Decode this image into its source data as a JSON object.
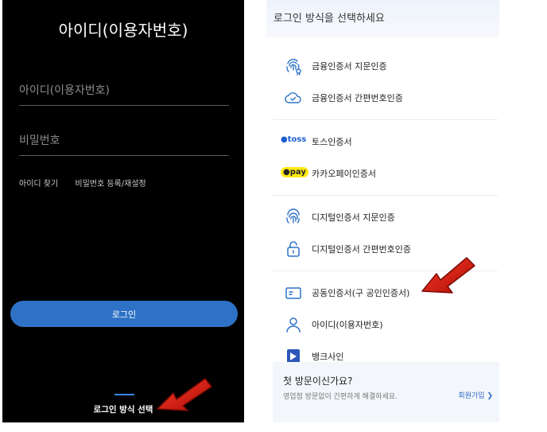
{
  "left": {
    "title": "아이디(이용자번호)",
    "id_placeholder": "아이디(이용자번호)",
    "pw_placeholder": "비밀번호",
    "find_id": "아이디 찾기",
    "pw_register": "비밀번호 등록/재설정",
    "login_button": "로그인",
    "method_select": "로그인 방식 선택"
  },
  "right": {
    "header_title": "로그인 방식을 선택하세요",
    "items": [
      {
        "label": "금융인증서 지문인증",
        "icon": "fingerprint-icon"
      },
      {
        "label": "금융인증서 간편번호인증",
        "icon": "cloud-check-icon"
      },
      {
        "label": "토스인증서",
        "brand": "toss"
      },
      {
        "label": "카카오페이인증서",
        "brand": "pay"
      },
      {
        "label": "디지털인증서 지문인증",
        "icon": "fingerprint-icon"
      },
      {
        "label": "디지털인증서 간편번호인증",
        "icon": "lock-icon"
      },
      {
        "label": "공동인증서(구 공인인증서)",
        "icon": "card-icon"
      },
      {
        "label": "아이디(이용자번호)",
        "icon": "person-icon"
      },
      {
        "label": "뱅크사인",
        "icon": "banksign-icon"
      }
    ],
    "footer": {
      "question": "첫 방문이신가요?",
      "subtitle": "영업점 방문없이 간편하게 해결하세요.",
      "join": "회원가입 ❯"
    }
  },
  "colors": {
    "accent_blue": "#2e72c7",
    "arrow_red": "#d0160c",
    "kakao_yellow": "#ffe812"
  }
}
